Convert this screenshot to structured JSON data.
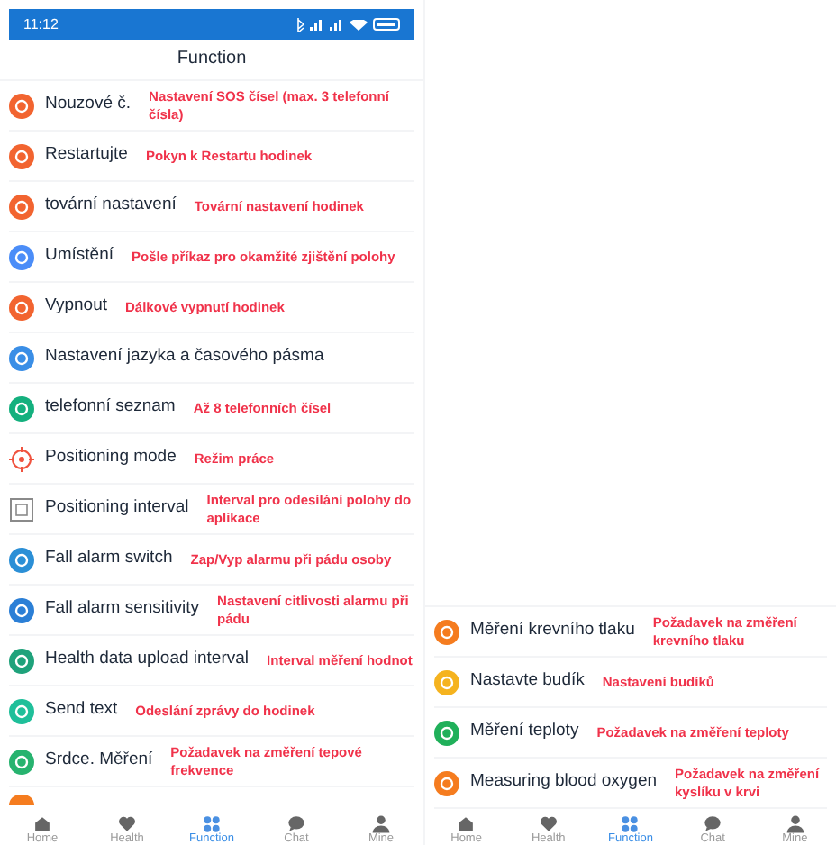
{
  "left_screen": {
    "status_bar": {
      "time": "11:12"
    },
    "title": "Function",
    "items": [
      {
        "label": "Nouzové č.",
        "note": "Nastavení SOS čísel (max. 3 telefonní čísla)"
      },
      {
        "label": "Restartujte",
        "note": "Pokyn k Restartu hodinek"
      },
      {
        "label": "tovární nastavení",
        "note": "Tovární nastavení hodinek"
      },
      {
        "label": "Umístění",
        "note": "Pošle příkaz pro okamžité zjištění polohy"
      },
      {
        "label": "Vypnout",
        "note": "Dálkové vypnutí hodinek"
      },
      {
        "label": "Nastavení jazyka a časového pásma"
      },
      {
        "label": "telefonní seznam",
        "note": "Až 8 telefonních čísel"
      },
      {
        "label": "Positioning mode",
        "note": "Režim práce"
      },
      {
        "label": "Positioning interval",
        "note": "Interval pro odesílání polohy do aplikace"
      },
      {
        "label": "Fall alarm switch",
        "note": "Zap/Vyp alarmu při pádu osoby"
      },
      {
        "label": "Fall alarm sensitivity",
        "note": "Nastavení citlivosti alarmu při pádu"
      },
      {
        "label": "Health data upload interval",
        "note": "Interval měření hodnot"
      },
      {
        "label": "Send text",
        "note": "Odeslání zprávy do hodinek"
      },
      {
        "label": "Srdce. Měření",
        "note": "Požadavek na změření tepové frekvence"
      }
    ],
    "tabs": [
      {
        "label": "Home",
        "selected": false
      },
      {
        "label": "Health",
        "selected": false
      },
      {
        "label": "Function",
        "selected": true
      },
      {
        "label": "Chat",
        "selected": false
      },
      {
        "label": "Mine",
        "selected": false
      }
    ]
  },
  "right_screen": {
    "items": [
      {
        "label": "Měření krevního tlaku",
        "note": "Požadavek na změření krevního tlaku"
      },
      {
        "label": "Nastavte budík",
        "note": "Nastavení budíků"
      },
      {
        "label": "Měření teploty",
        "note": "Požadavek na změření teploty"
      },
      {
        "label": "Measuring blood oxygen",
        "note": "Požadavek na změření kyslíku v krvi"
      }
    ],
    "tabs": [
      {
        "label": "Home",
        "selected": false
      },
      {
        "label": "Health",
        "selected": false
      },
      {
        "label": "Function",
        "selected": true
      },
      {
        "label": "Chat",
        "selected": false
      },
      {
        "label": "Mine",
        "selected": false
      }
    ]
  }
}
